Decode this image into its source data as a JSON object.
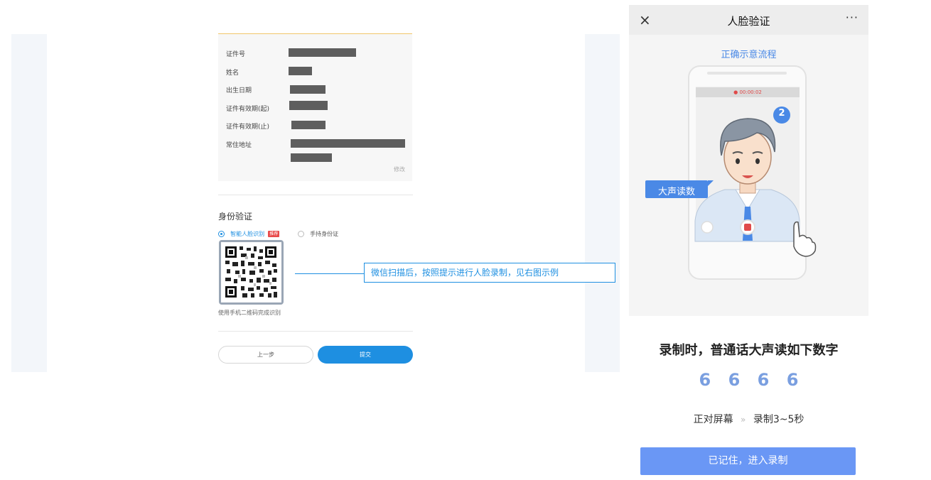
{
  "form": {
    "fields": [
      {
        "label": "证件号"
      },
      {
        "label": "姓名"
      },
      {
        "label": "出生日期"
      },
      {
        "label": "证件有效期(起)"
      },
      {
        "label": "证件有效期(止)"
      },
      {
        "label": "常住地址"
      }
    ],
    "edit_label": "修改"
  },
  "identity": {
    "title": "身份验证",
    "option_face": "智能人脸识别",
    "badge": "推荐",
    "option_manual": "手持身份证",
    "qr_caption": "使用手机二维码完成识别"
  },
  "buttons": {
    "prev": "上一步",
    "submit": "提交"
  },
  "callout": "微信扫描后，按照提示进行人脸录制，见右图示例",
  "phone": {
    "close_icon": "×",
    "title": "人脸验证",
    "more_icon": "···",
    "demo_title": "正确示意流程",
    "timer": "● 00:00:02",
    "bubble_number": "2",
    "read_tag": "大声读数",
    "instruction": "录制时，普通话大声读如下数字",
    "digits": [
      "6",
      "6",
      "6",
      "6"
    ],
    "step1": "正对屏幕",
    "step_arrow": "»",
    "step2": "录制3~5秒",
    "record_button": "已记住，进入录制"
  },
  "colors": {
    "accent": "#1e8fe1",
    "phone_blue": "#6a97f5",
    "digit_color": "#7a9fe0"
  }
}
